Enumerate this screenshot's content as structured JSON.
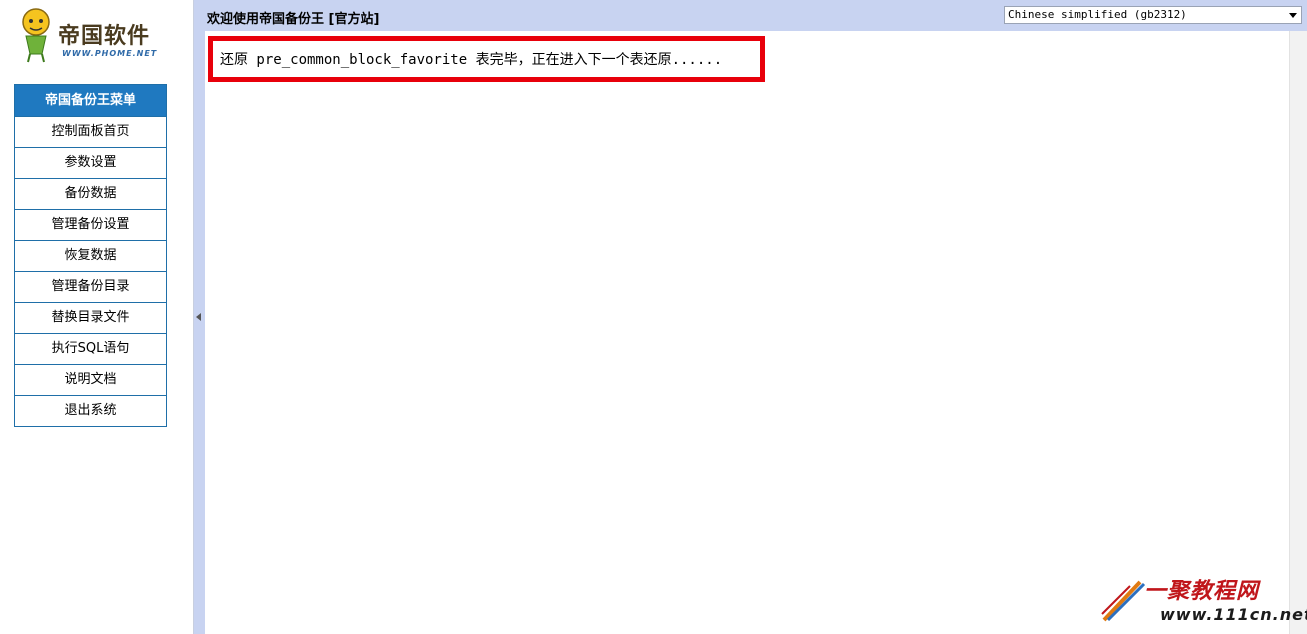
{
  "logo": {
    "text": "帝国软件",
    "subtext": "WWW.PHOME.NET"
  },
  "menu": {
    "title": "帝国备份王菜单",
    "items": [
      {
        "label": "控制面板首页"
      },
      {
        "label": "参数设置"
      },
      {
        "label": "备份数据"
      },
      {
        "label": "管理备份设置"
      },
      {
        "label": "恢复数据"
      },
      {
        "label": "管理备份目录"
      },
      {
        "label": "替换目录文件"
      },
      {
        "label": "执行SQL语句"
      },
      {
        "label": "说明文档"
      },
      {
        "label": "退出系统"
      }
    ]
  },
  "header": {
    "welcome": "欢迎使用帝国备份王 [官方站]",
    "language_selected": "Chinese simplified (gb2312)"
  },
  "main": {
    "status_message": "还原 pre_common_block_favorite 表完毕，正在进入下一个表还原......"
  },
  "watermark": {
    "title": "一聚教程网",
    "url": "www.111cn.net"
  },
  "colors": {
    "menu_header": "#1f79c0",
    "frame_bar": "#c8d3f1",
    "highlight_border": "#e8000b"
  }
}
